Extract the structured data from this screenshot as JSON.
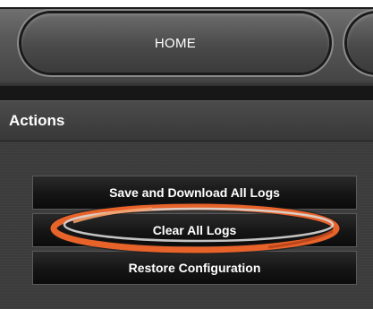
{
  "nav": {
    "home_label": "HOME"
  },
  "actions": {
    "title": "Actions",
    "buttons": [
      {
        "label": "Save and Download All Logs"
      },
      {
        "label": "Clear All Logs"
      },
      {
        "label": "Restore Configuration"
      }
    ]
  },
  "colors": {
    "highlight": "#e8632a",
    "button_bg": "#111111",
    "text": "#ffffff"
  }
}
